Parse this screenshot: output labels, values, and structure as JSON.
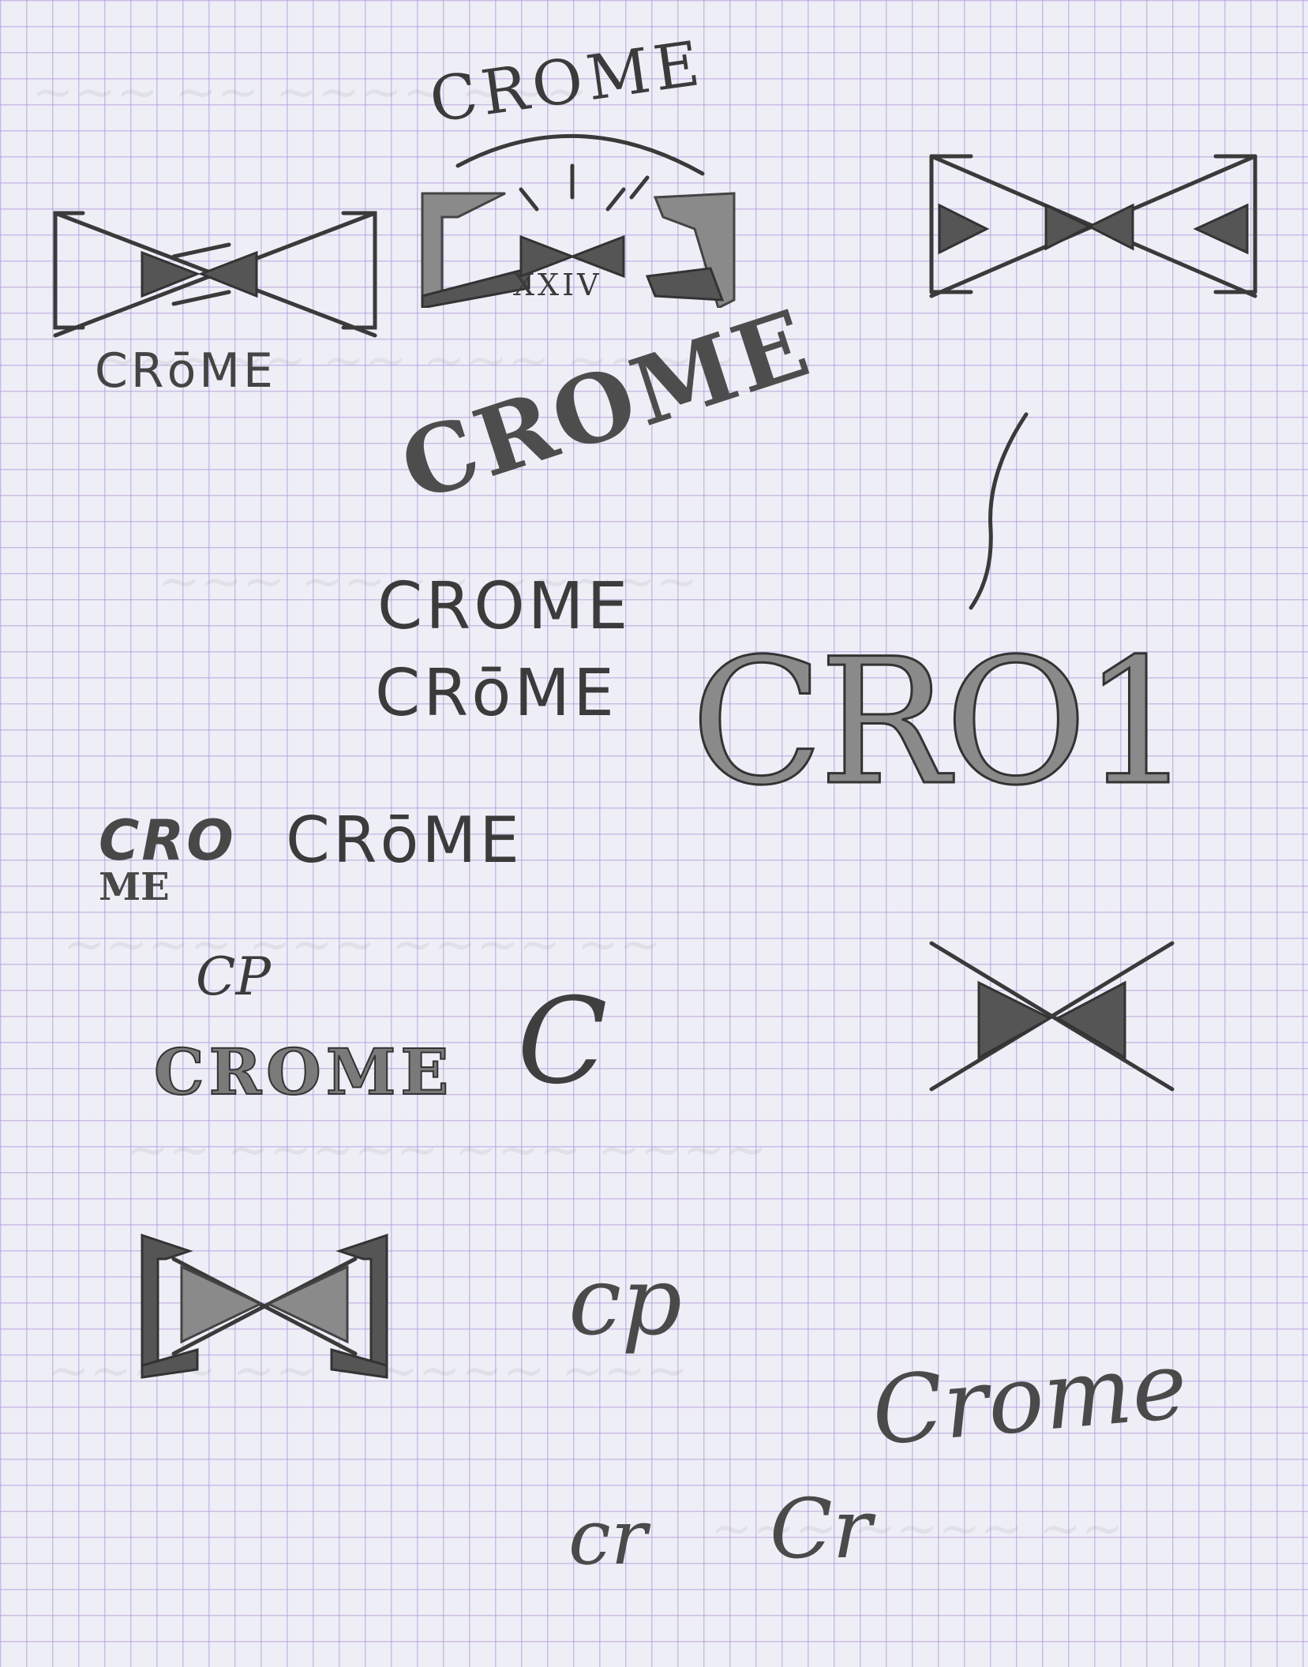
{
  "page": {
    "paper_color": "#eeeef6",
    "grid_color": "#b096d7",
    "ink_color": "#3b3b3b"
  },
  "sketches": {
    "bowtie_logo_left": {
      "wordmark": "CRōME"
    },
    "badge": {
      "arc_text": "CROME",
      "numeral": "XXIV"
    },
    "arched_wordmark": {
      "text": "CROME"
    },
    "stack_plain": {
      "line1": "CROME",
      "line2": "CRōME"
    },
    "big_outline": {
      "text": "CRO1"
    },
    "split_stack": {
      "line1": "CRO",
      "line2": "ME"
    },
    "side_wordmark": {
      "text": "CRōME"
    },
    "monogram_cp": {
      "text": "CP"
    },
    "engraved_wordmark": {
      "text": "CROME"
    },
    "lone_c": {
      "text": "C"
    },
    "script_cp": {
      "text": "cp"
    },
    "script_crome": {
      "text": "Crome"
    },
    "script_cr_left": {
      "text": "cr"
    },
    "script_cr_right": {
      "text": "Cr"
    }
  }
}
